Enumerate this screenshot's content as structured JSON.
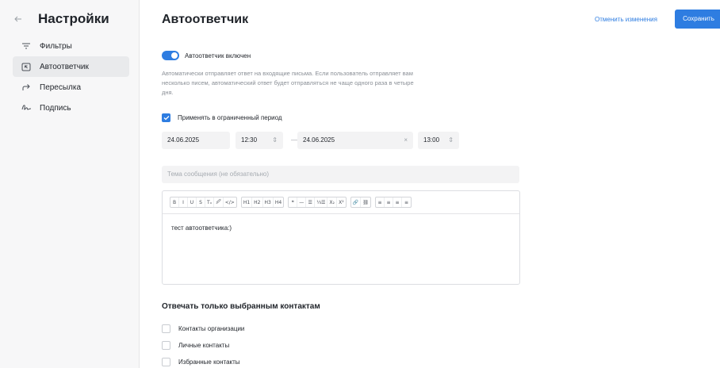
{
  "sidebar": {
    "title": "Настройки",
    "back_icon": "arrow-left-icon",
    "items": [
      {
        "label": "Фильтры",
        "icon": "filter-icon",
        "active": false
      },
      {
        "label": "Автоответчик",
        "icon": "autoreply-icon",
        "active": true
      },
      {
        "label": "Пересылка",
        "icon": "forward-icon",
        "active": false
      },
      {
        "label": "Подпись",
        "icon": "signature-icon",
        "active": false
      }
    ]
  },
  "header": {
    "title": "Автоответчик",
    "cancel_label": "Отменить изменения",
    "save_label": "Сохранить"
  },
  "autoreply": {
    "enabled": true,
    "toggle_label": "Автоответчик включен",
    "description": "Автоматически отправляет ответ на входящие письма. Если пользователь отправляет вам несколько писем, автоматический ответ будет отправляться не чаще одного раза в четыре дня."
  },
  "period": {
    "checked": true,
    "label": "Применять в ограниченный период",
    "start_date": "24.06.2025",
    "start_time": "12:30",
    "dash": "—",
    "end_date": "24.06.2025",
    "end_time": "13:00",
    "clear_symbol": "×",
    "stepper_symbol": "⇕"
  },
  "subject": {
    "placeholder": "Тема сообщения (не обязательно)"
  },
  "editor": {
    "toolbar_groups": [
      [
        "B",
        "I",
        "U",
        "S",
        "Tₓ",
        "🖉",
        "</>"
      ],
      [
        "H1",
        "H2",
        "H3",
        "H4"
      ],
      [
        "❝",
        "—",
        "☰",
        "⅓☰",
        "X₂",
        "X²"
      ],
      [
        "🔗",
        "⛓"
      ],
      [
        "≡",
        "≡",
        "≡",
        "≡"
      ]
    ],
    "content": "тест автоответчика:)"
  },
  "contacts_section": {
    "title": "Отвечать только выбранным контактам",
    "options": [
      {
        "label": "Контакты организации",
        "checked": false
      },
      {
        "label": "Личные контакты",
        "checked": false
      },
      {
        "label": "Избранные контакты",
        "checked": false
      }
    ]
  },
  "colors": {
    "accent": "#2e7de1",
    "sidebar_bg": "#f7f7f8",
    "field_bg": "#f3f3f4"
  }
}
